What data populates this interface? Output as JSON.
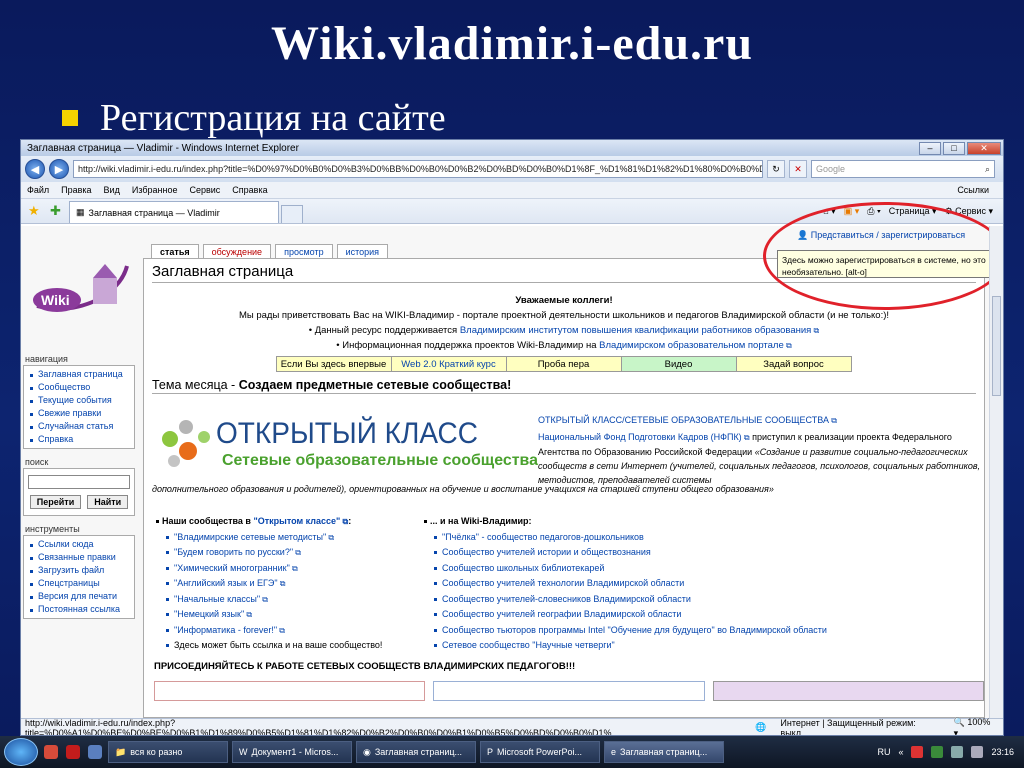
{
  "slide": {
    "title": "Wiki.vladimir.i-edu.ru",
    "bullet": "Регистрация на сайте"
  },
  "browser": {
    "window_title": "Заглавная страница — Vladimir - Windows Internet Explorer",
    "url": "http://wiki.vladimir.i-edu.ru/index.php?title=%D0%97%D0%B0%D0%B3%D0%BB%D0%B0%D0%B2%D0%BD%D0%B0%D1%8F_%D1%81%D1%82%D1%80%D0%B0%D0%BD%D0%B8%D1%86%D0%B0",
    "search_placeholder": "Google",
    "menu": [
      "Файл",
      "Правка",
      "Вид",
      "Избранное",
      "Сервис",
      "Справка"
    ],
    "links_label": "Ссылки",
    "tab_label": "Заглавная страница — Vladimir",
    "cmd_page": "Страница",
    "cmd_service": "Сервис",
    "status_url": "http://wiki.vladimir.i-edu.ru/index.php?title=%D0%A1%D0%BE%D0%BE%D0%B1%D1%89%D0%B5%D1%81%D1%82%D0%B2%D0%B0%D0%B1%D0%B5%D0%BD%D0%B0%D1%",
    "status_zone": "Интернет | Защищенный режим: выкл.",
    "zoom": "100%"
  },
  "wiki": {
    "logo_text": "Wiki",
    "page_tabs": [
      "статья",
      "обсуждение",
      "просмотр",
      "история"
    ],
    "login_link": "Представиться / зарегистрироваться",
    "tooltip": "Здесь можно зарегистрироваться в системе, но это необязательно. [alt-o]",
    "nav_heading": "навигация",
    "nav_items": [
      "Заглавная страница",
      "Сообщество",
      "Текущие события",
      "Свежие правки",
      "Случайная статья",
      "Справка"
    ],
    "search_heading": "поиск",
    "search_go": "Перейти",
    "search_find": "Найти",
    "tools_heading": "инструменты",
    "tools_items": [
      "Ссылки сюда",
      "Связанные правки",
      "Загрузить файл",
      "Спецстраницы",
      "Версия для печати",
      "Постоянная ссылка"
    ],
    "page_title": "Заглавная страница",
    "greeting": "Уважаемые коллеги!",
    "welcome": "Мы рады приветствовать Вас на WIKI-Владимир - портале проектной деятельности школьников и педагогов Владимирской области (и не только:)!",
    "support1_text": "Данный ресурс поддерживается",
    "support1_link": "Владимирским институтом повышения квалификации работников образования",
    "support2_text": "Информационная поддержка проектов Wiki-Владимир на",
    "support2_link": "Владимирском образовательном портале",
    "quick_links": [
      "Если Вы здесь впервые",
      "Web 2.0 Краткий курс",
      "Проба пера",
      "Видео",
      "Задай вопрос"
    ],
    "quick_colors": [
      "#ffffc0",
      "#ffffc0",
      "#ffffc0",
      "#c8f5c8",
      "#ffffc0"
    ],
    "theme_prefix": "Тема месяца - ",
    "theme_bold": "Создаем предметные сетевые сообщества!",
    "ok_title": "ОТКРЫТЫЙ КЛАСС",
    "ok_subtitle": "Сетевые образовательные сообщества",
    "ok_link": "ОТКРЫТЫЙ КЛАСС/СЕТЕВЫЕ ОБРАЗОВАТЕЛЬНЫЕ СООБЩЕСТВА",
    "nfpk_link": "Национальный Фонд Подготовки Кадров (НФПК)",
    "nfpk_text": "приступил к реализации проекта Федерального Агентства по Образованию Российской Федерации",
    "ok_desc_start": "«Создание и развитие социально-педагогических сообществ в сети Интернет (учителей, социальных педагогов, психологов, социальных работников, методистов, преподавателей системы",
    "ok_desc_rest": "дополнительного образования и родителей), ориентированных на обучение и воспитание учащихся на старшей ступени общего образования»",
    "left_head_prefix": "Наши сообщества в ",
    "left_head_link": "\"Открытом классе\"",
    "left_items": [
      "\"Владимирские сетевые методисты\"",
      "\"Будем говорить по русски?\"",
      "\"Химический многогранник\"",
      "\"Английский язык и ЕГЭ\"",
      "\"Начальные классы\"",
      "\"Немецкий язык\"",
      "\"Информатика - forever!\""
    ],
    "left_last": "Здесь может быть ссылка и на ваше сообщество!",
    "right_head": "... и на Wiki-Владимир:",
    "right_items": [
      "\"Пчёлка\" - сообщество педагогов-дошкольников",
      "Сообщество учителей истории и обществознания",
      "Сообщество школьных библиотекарей",
      "Сообщество учителей технологии Владимирской области",
      "Сообщество учителей-словесников Владимирской области",
      "Сообщество учителей географии Владимирской области",
      "Сообщество тьюторов программы Intel \"Обучение для будущего\" во Владимирской области",
      "Сетевое сообщество \"Научные четверги\""
    ],
    "join": "ПРИСОЕДИНЯЙТЕСЬ К РАБОТЕ СЕТЕВЫХ СООБЩЕСТВ ВЛАДИМИРСКИХ ПЕДАГОГОВ!!!"
  },
  "taskbar": {
    "tasks": [
      "вся ко разно",
      "Документ1 - Micros...",
      "Заглавная страниц...",
      "Microsoft PowerPoi...",
      "Заглавная страниц..."
    ],
    "lang": "RU",
    "clock": "23:16"
  },
  "colors": {
    "slide_bg": "#0d2470",
    "bullet": "#f5d300",
    "highlight": "#e0212a",
    "link": "#0645ad",
    "ok_blue": "#1f4a8a",
    "ok_green": "#4aa12e"
  }
}
